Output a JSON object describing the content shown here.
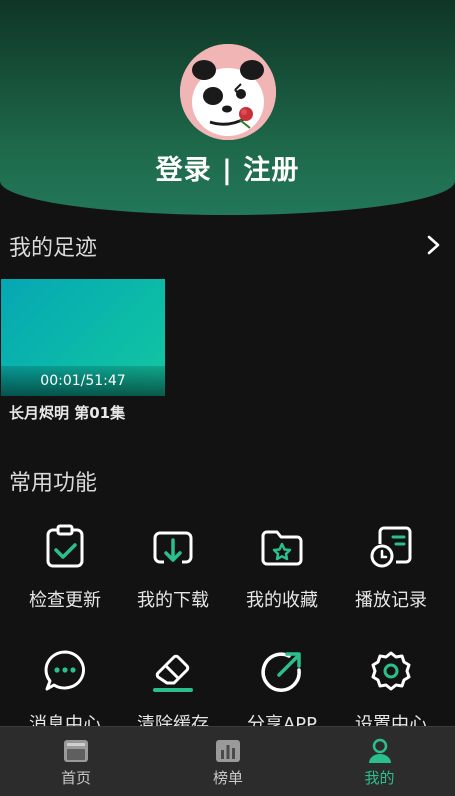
{
  "header": {
    "login_text": "登录 | 注册"
  },
  "history": {
    "title": "我的足迹",
    "items": [
      {
        "duration": "00:01/51:47",
        "title": "长月烬明 第01集"
      }
    ]
  },
  "features": {
    "title": "常用功能",
    "items": [
      {
        "label": "检查更新",
        "icon": "clipboard-check-icon"
      },
      {
        "label": "我的下载",
        "icon": "download-icon"
      },
      {
        "label": "我的收藏",
        "icon": "folder-star-icon"
      },
      {
        "label": "播放记录",
        "icon": "history-clock-icon"
      },
      {
        "label": "消息中心",
        "icon": "message-icon"
      },
      {
        "label": "清除缓存",
        "icon": "eraser-icon"
      },
      {
        "label": "分享APP",
        "icon": "share-icon"
      },
      {
        "label": "设置中心",
        "icon": "settings-icon"
      }
    ]
  },
  "tabbar": {
    "items": [
      {
        "label": "首页",
        "icon": "home-icon",
        "active": false
      },
      {
        "label": "榜单",
        "icon": "chart-icon",
        "active": false
      },
      {
        "label": "我的",
        "icon": "user-icon",
        "active": true
      }
    ]
  },
  "colors": {
    "accent": "#2bbf8e",
    "background": "#121212",
    "header_green": "#1e6a4b",
    "tabbar": "#2c2c2c"
  }
}
